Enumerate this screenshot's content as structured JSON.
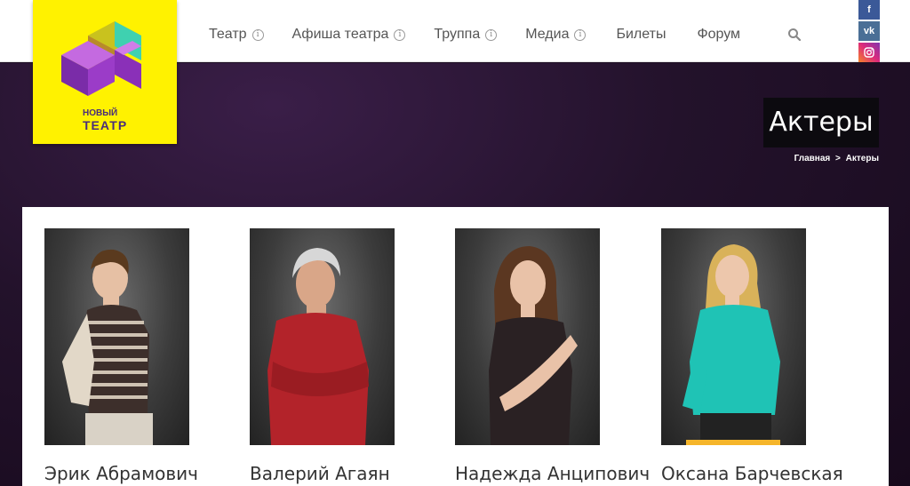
{
  "nav": {
    "items": [
      {
        "label": "Театр",
        "has_info": true
      },
      {
        "label": "Афиша театра",
        "has_info": true
      },
      {
        "label": "Труппа",
        "has_info": true
      },
      {
        "label": "Медиа",
        "has_info": true
      },
      {
        "label": "Билеты",
        "has_info": false
      },
      {
        "label": "Форум",
        "has_info": false
      }
    ],
    "info_glyph": "i",
    "search_icon": "search-icon"
  },
  "social": {
    "facebook": "f",
    "vk": "vk",
    "instagram": "instagram-icon"
  },
  "logo": {
    "line1": "НОВЫЙ",
    "line2": "ТЕАТР",
    "color_bg": "#fff200",
    "color_brand": "#4a2d7a"
  },
  "page": {
    "title": "Актеры",
    "breadcrumb": {
      "home": "Главная",
      "separator": ">",
      "current": "Актеры"
    }
  },
  "actors": [
    {
      "name": "Эрик Абрамович",
      "shirt": "#d9cfc0",
      "hair": "#5a3a1e"
    },
    {
      "name": "Валерий Агаян",
      "shirt": "#b3232a",
      "hair": "#cfcfcf"
    },
    {
      "name": "Надежда Анципович",
      "shirt": "#2a2123",
      "hair": "#5b3721"
    },
    {
      "name": "Оксана Барчевская",
      "shirt": "#1fc3b5",
      "hair": "#d9b25a"
    }
  ]
}
